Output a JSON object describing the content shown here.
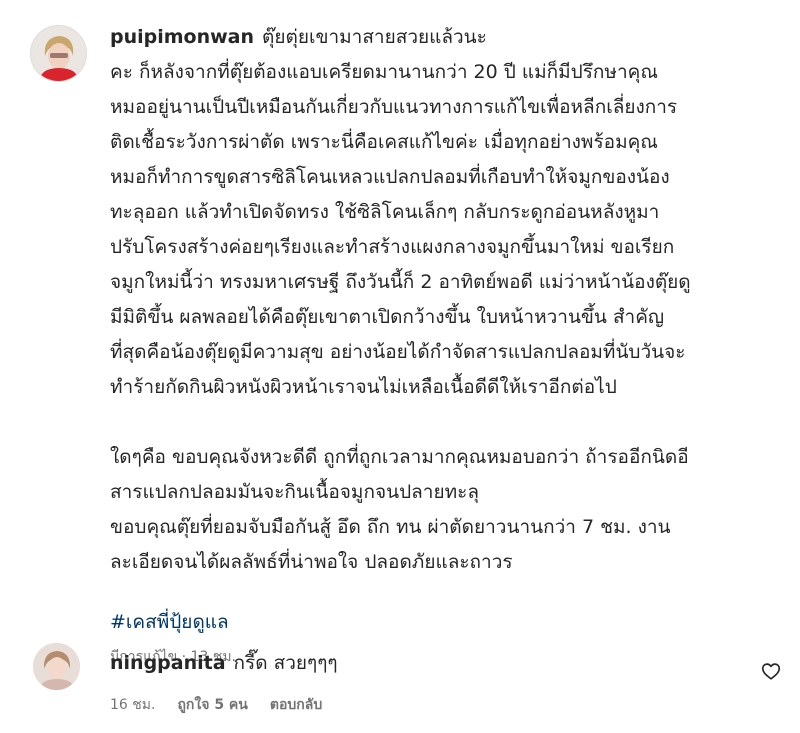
{
  "post": {
    "username": "puipimonwan",
    "first_line": "ตุ๊ยตุ่ยเขามาสายสวยแล้วนะ",
    "body_lines": [
      "คะ ก็หลังจากที่ตุ๊ยต้องแอบเครียดมานานกว่า 20 ปี แม่ก็มีปรึกษาคุณ",
      "หมออยู่นานเป็นปีเหมือนกันเกี่ยวกับแนวทางการแก้ไขเพื่อหลีกเลี่ยงการ",
      "ติดเชื้อระวังการผ่าตัด เพราะนี่คือเคสแก้ไขค่ะ เมื่อทุกอย่างพร้อมคุณ",
      "หมอก็ทำการขูดสารซิลิโคนเหลวแปลกปลอมที่เกือบทำให้จมูกของน้อง",
      "ทะลุออก แล้วทำเปิดจัดทรง ใช้ซิลิโคนเล็กๆ กลับกระดูกอ่อนหลังหูมา",
      "ปรับโครงสร้างค่อยๆเรียงและทำสร้างแผงกลางจมูกขึ้นมาใหม่ ขอเรียก",
      "จมูกใหม่นี้ว่า ทรงมหาเศรษฐี ถึงวันนี้ก็ 2 อาทิตย์พอดี แม่ว่าหน้าน้องตุ๊ยดู",
      "มีมิติขึ้น ผลพลอยได้คือตุ๊ยเขาตาเปิดกว้างขึ้น ใบหน้าหวานขึ้น สำคัญ",
      "ที่สุดคือน้องตุ๊ยดูมีความสุข อย่างน้อยได้กำจัดสารแปลกปลอมที่นับวันจะ",
      "ทำร้ายกัดกินผิวหนังผิวหน้าเราจนไม่เหลือเนื้อดีดีให้เราอีกต่อไป"
    ],
    "body2_lines": [
      "ใดๆคือ ขอบคุณจังหวะดีดี ถูกที่ถูกเวลามากคุณหมอบอกว่า ถ้ารออีกนิดอี",
      "สารแปลกปลอมมันจะกินเนื้อจมูกจนปลายทะลุ",
      "ขอบคุณตุ๊ยที่ยอมจับมือกันสู้ อึด ถึก ทน ผ่าตัดยาวนานกว่า 7 ชม. งาน",
      "ละเอียดจนได้ผลลัพธ์ที่น่าพอใจ ปลอดภัยและถาวร"
    ],
    "hashtag": "#เคสพี่ปุ้ยดูแล",
    "meta": "มีการแก้ไข · 13 ชม."
  },
  "reply": {
    "username": "ningpanita",
    "text": "กรี๊ด สวยๆๆๆ",
    "time": "16 ชม.",
    "likes": "ถูกใจ 5 คน",
    "reply_label": "ตอบกลับ"
  },
  "icons": {
    "like": "heart-outline-icon"
  },
  "colors": {
    "hashtag": "#00376b",
    "meta": "#737373",
    "text": "#262626"
  }
}
